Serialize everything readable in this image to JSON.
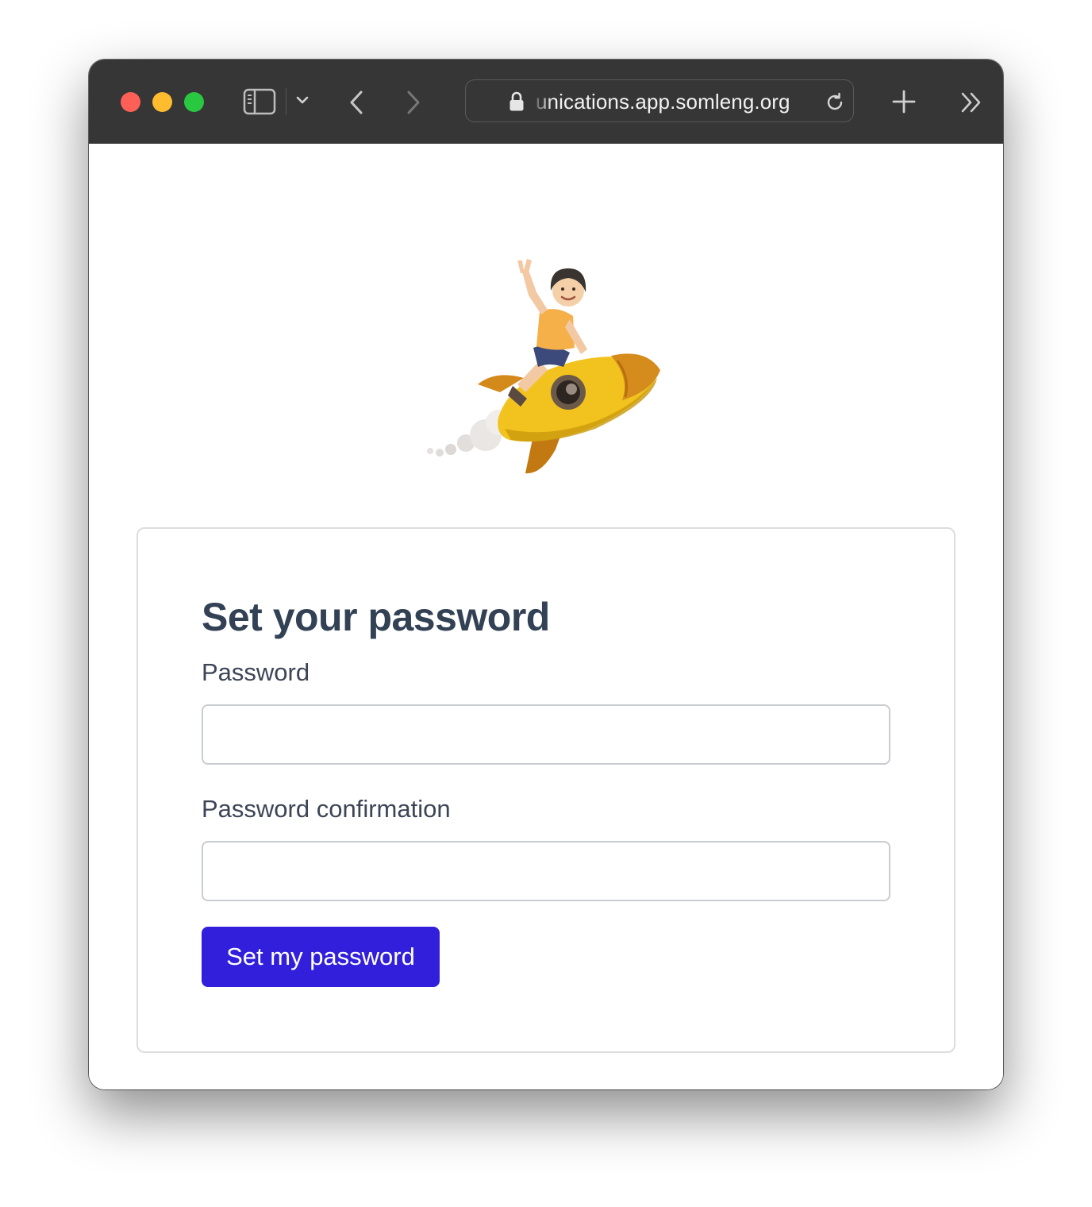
{
  "browser": {
    "url": "unications.app.somleng.org",
    "icons": {
      "close": "close-window-icon",
      "minimize": "minimize-window-icon",
      "zoom": "zoom-window-icon",
      "sidebar": "sidebar-icon",
      "dropdown": "chevron-down-icon",
      "back": "chevron-left-icon",
      "forward": "chevron-right-icon",
      "lock": "lock-icon",
      "reload": "reload-icon",
      "new_tab": "plus-icon",
      "more": "double-chevron-right-icon"
    },
    "colors": {
      "toolbar": "#363636",
      "close": "#fe5f57",
      "minimize": "#febc2e",
      "zoom": "#28c840"
    }
  },
  "page": {
    "hero_image": "astronaut-child-riding-rocket-illustration",
    "title": "Set your password",
    "fields": {
      "password_label": "Password",
      "password_value": "",
      "confirmation_label": "Password confirmation",
      "confirmation_value": ""
    },
    "submit_label": "Set my password",
    "colors": {
      "primary": "#321fdb",
      "heading": "#334155"
    }
  }
}
